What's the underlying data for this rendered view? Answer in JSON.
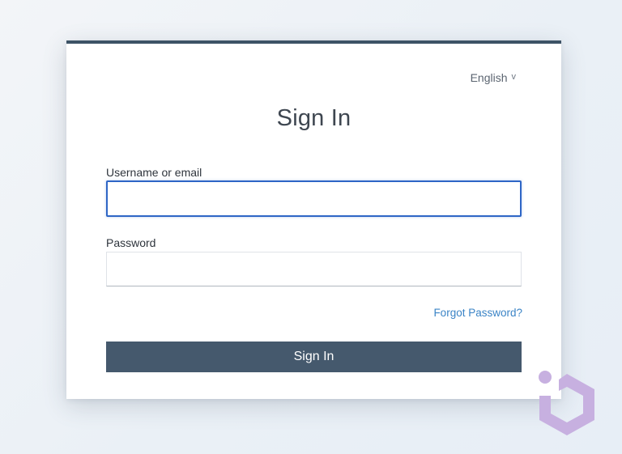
{
  "language": {
    "current": "English",
    "chevron": "v"
  },
  "form": {
    "title": "Sign In",
    "username_label": "Username or email",
    "username_value": "",
    "password_label": "Password",
    "password_value": "",
    "forgot_password": "Forgot Password?",
    "submit_label": "Sign In"
  },
  "colors": {
    "accent_border": "#3d5366",
    "button": "#45596d",
    "focus": "#2e66c6",
    "link": "#3b84c6",
    "brand_mark": "#c7b0e0"
  }
}
